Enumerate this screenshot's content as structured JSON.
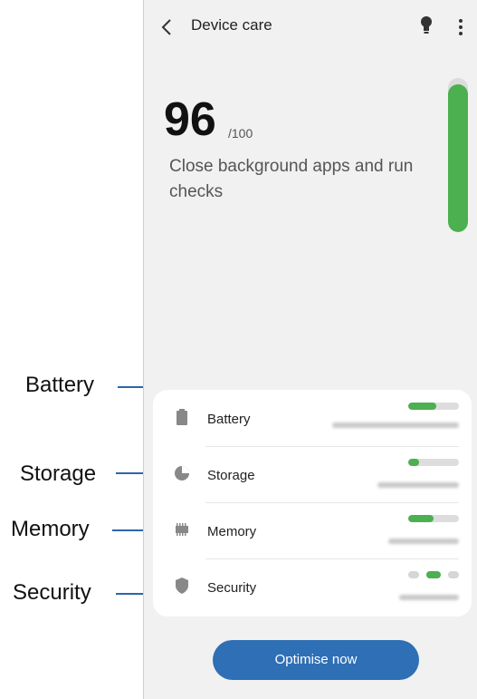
{
  "header": {
    "title": "Device care",
    "back_icon": "chevron-left-icon",
    "tips_icon": "lightbulb-icon",
    "more_icon": "more-vert-icon"
  },
  "score": {
    "value": "96",
    "max": "/100",
    "message": "Close background apps and run checks",
    "level": 0.96
  },
  "rows": [
    {
      "label": "Battery",
      "icon": "battery-icon",
      "usage_fraction": 0.55
    },
    {
      "label": "Storage",
      "icon": "storage-pie-icon",
      "usage_fraction": 0.22
    },
    {
      "label": "Memory",
      "icon": "memory-chip-icon",
      "usage_fraction": 0.5
    },
    {
      "label": "Security",
      "icon": "shield-icon",
      "status": "three-dot-indicator"
    }
  ],
  "action": {
    "label": "Optimise now"
  },
  "callouts": [
    "Battery",
    "Storage",
    "Memory",
    "Security"
  ],
  "colors": {
    "accent_green": "#4caf50",
    "button_blue": "#2e6fb5",
    "leader_blue": "#2c66a8"
  }
}
